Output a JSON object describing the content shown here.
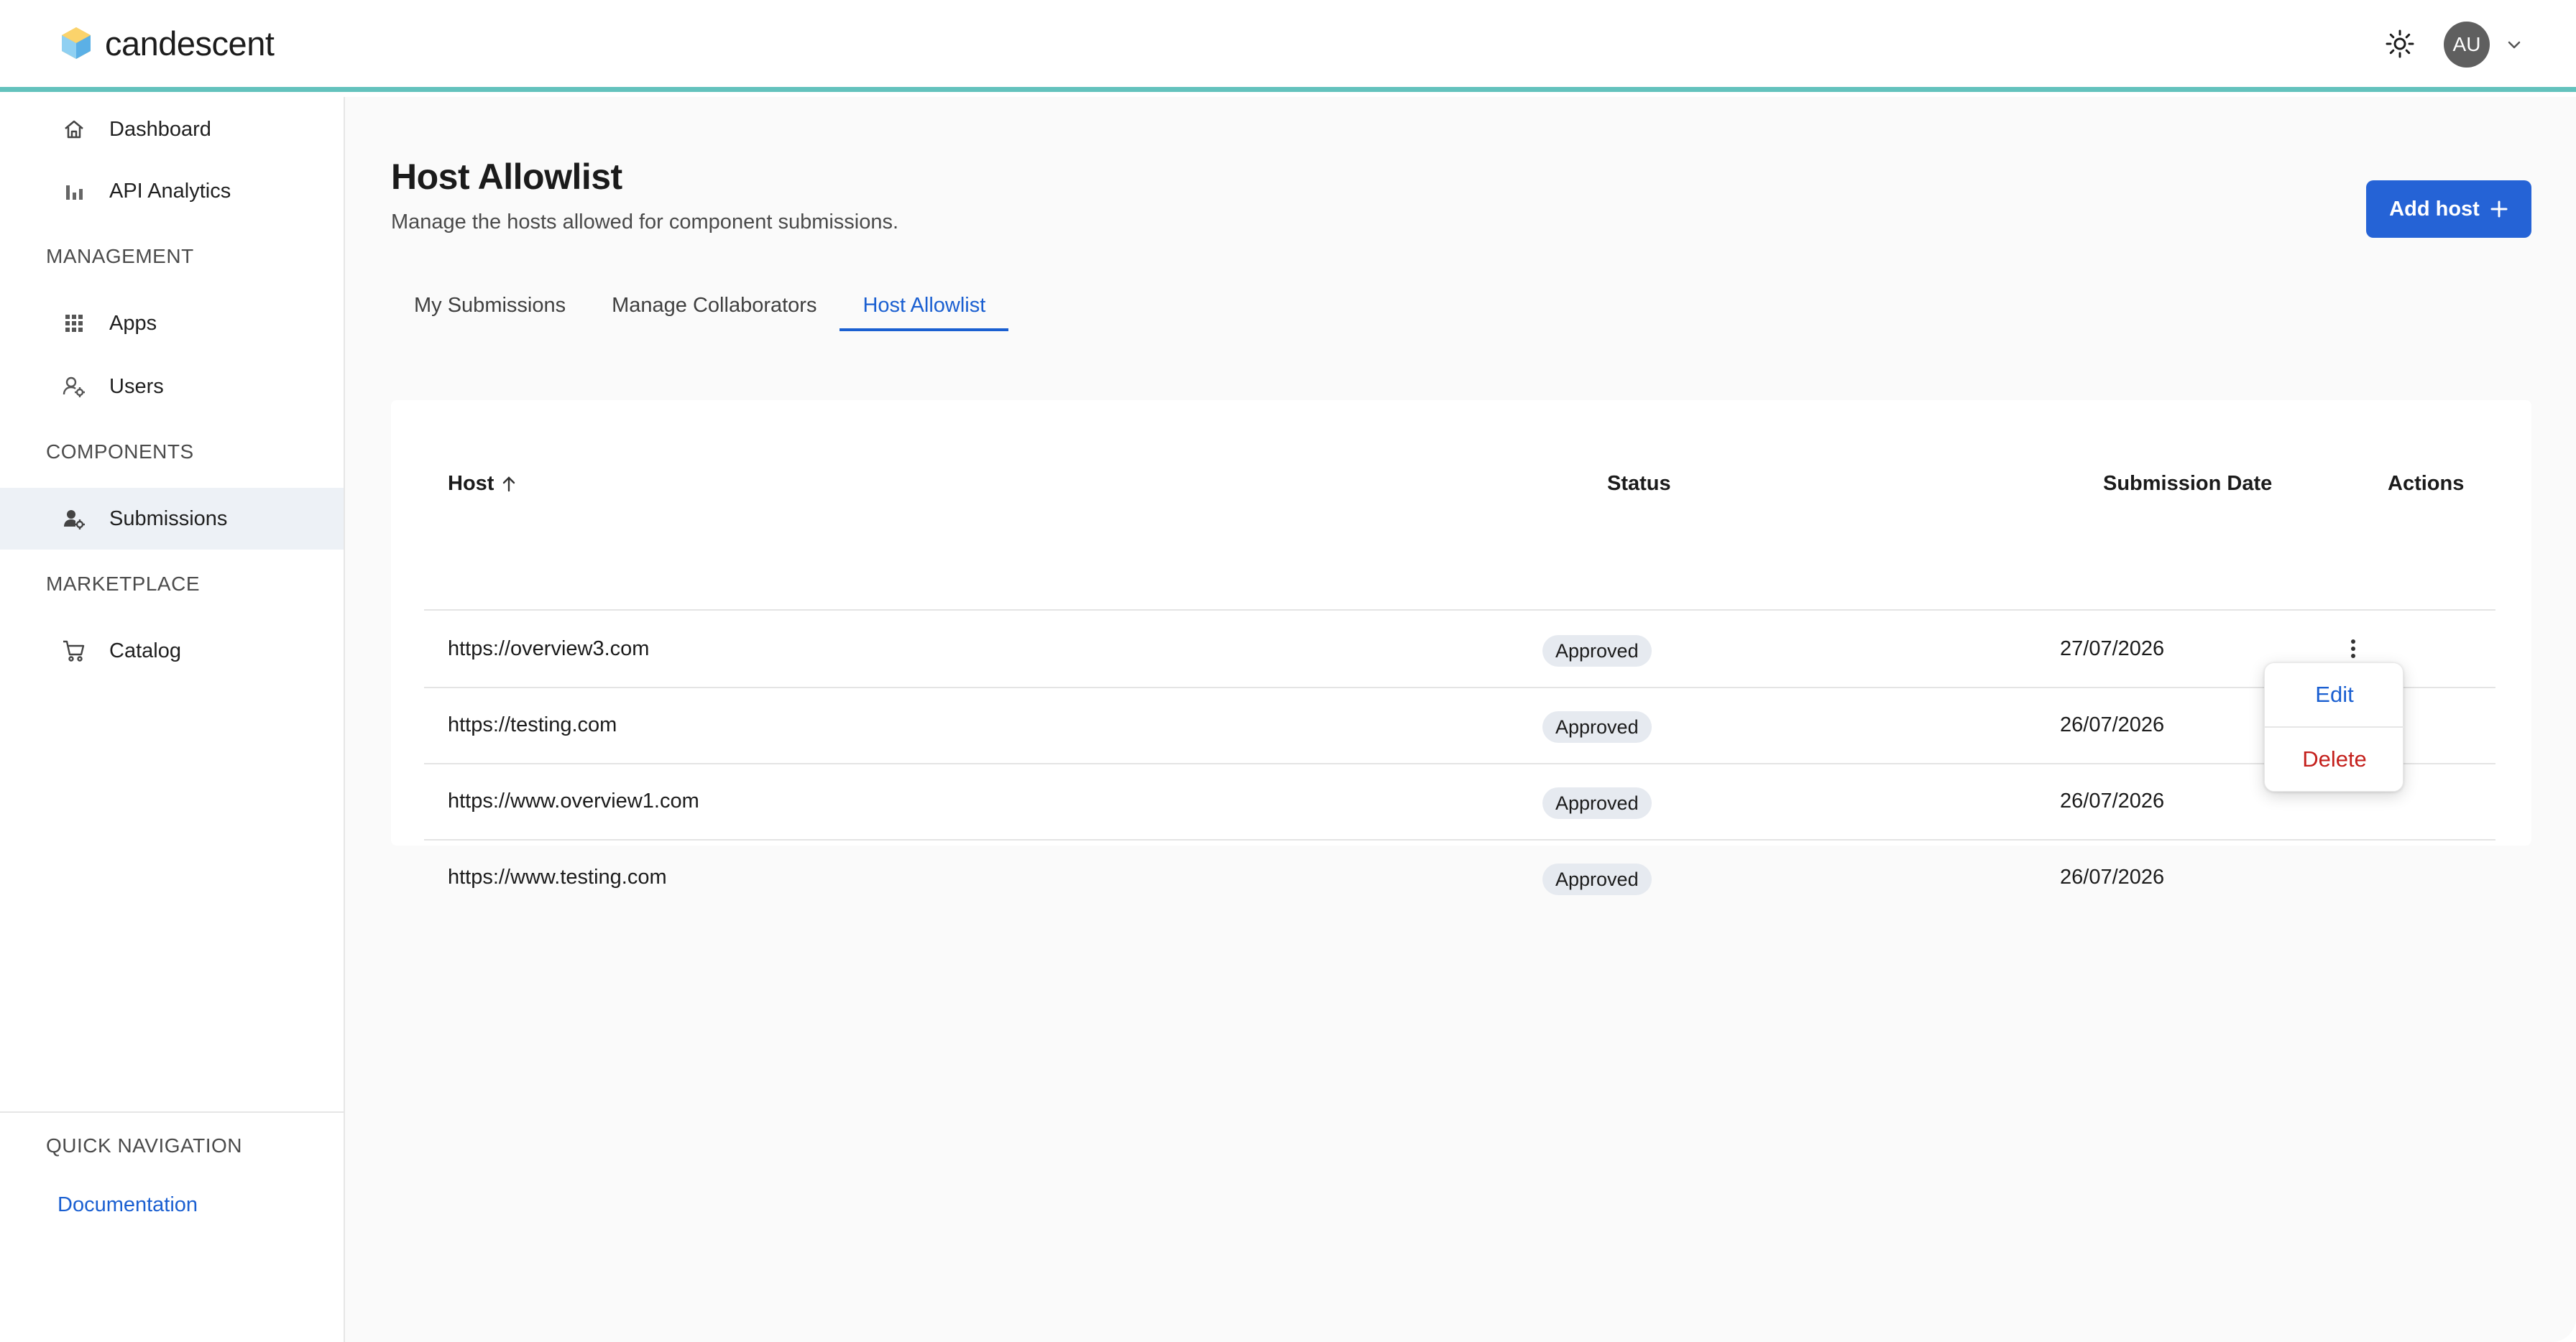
{
  "header": {
    "brand": "candescent",
    "avatar_initials": "AU",
    "accent_color": "#63c2bd",
    "icons": [
      "logo-hexagon-icon",
      "sun-icon",
      "chevron-down-icon"
    ]
  },
  "sidebar": {
    "items": [
      {
        "label": "Dashboard",
        "icon": "home-icon"
      },
      {
        "label": "API Analytics",
        "icon": "bar-chart-icon"
      }
    ],
    "sections": [
      {
        "title": "MANAGEMENT",
        "items": [
          {
            "label": "Apps",
            "icon": "grid-icon"
          },
          {
            "label": "Users",
            "icon": "user-settings-icon"
          }
        ]
      },
      {
        "title": "COMPONENTS",
        "items": [
          {
            "label": "Submissions",
            "icon": "user-gear-icon",
            "active": true
          }
        ]
      },
      {
        "title": "MARKETPLACE",
        "items": [
          {
            "label": "Catalog",
            "icon": "cart-icon"
          }
        ]
      }
    ],
    "quick_nav": {
      "title": "QUICK NAVIGATION",
      "link": "Documentation"
    }
  },
  "main": {
    "title": "Host Allowlist",
    "subtitle": "Manage the hosts allowed for component submissions.",
    "add_button": "Add host",
    "tabs": [
      {
        "label": "My Submissions",
        "active": false
      },
      {
        "label": "Manage Collaborators",
        "active": false
      },
      {
        "label": "Host Allowlist",
        "active": true
      }
    ],
    "table": {
      "columns": [
        "Host",
        "Status",
        "Submission Date",
        "Actions"
      ],
      "sort": {
        "column": "Host",
        "direction": "ascending"
      },
      "rows": [
        {
          "host": "https://overview3.com",
          "status": "Approved",
          "date": "27/07/2026"
        },
        {
          "host": "https://testing.com",
          "status": "Approved",
          "date": "26/07/2026"
        },
        {
          "host": "https://www.overview1.com",
          "status": "Approved",
          "date": "26/07/2026"
        },
        {
          "host": "https://www.testing.com",
          "status": "Approved",
          "date": "26/07/2026"
        }
      ]
    },
    "row_menu": {
      "open_for_row": 1,
      "edit": "Edit",
      "delete": "Delete",
      "edit_color": "#1a5fd1",
      "delete_color": "#c4201c"
    }
  }
}
